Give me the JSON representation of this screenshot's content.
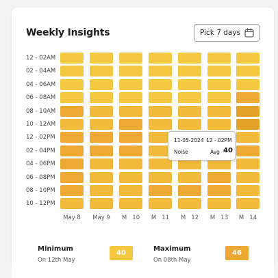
{
  "title": "Weekly Insights",
  "picker": {
    "label": "Pick 7 days",
    "icon": "calendar-icon"
  },
  "rows": [
    "12 - 02AM",
    "02 - 04AM",
    "04 - 06AM",
    "06 - 08AM",
    "08 - 10AM",
    "10 - 12AM",
    "12 - 02PM",
    "02 - 04PM",
    "04 - 06PM",
    "06 - 08PM",
    "08 - 10PM",
    "10 - 12PM"
  ],
  "columns": [
    "May 8",
    "May 9",
    "M   10",
    "M   11",
    "M   12",
    "M   13",
    "M   14"
  ],
  "heatmap_levels": [
    [
      0,
      0,
      0,
      0,
      0,
      0,
      0
    ],
    [
      0,
      0,
      0,
      0,
      0,
      0,
      0
    ],
    [
      0,
      0,
      0,
      0,
      0,
      0,
      0
    ],
    [
      0,
      0,
      0,
      0,
      0,
      0,
      2
    ],
    [
      2,
      1,
      1,
      1,
      1,
      1,
      3
    ],
    [
      1,
      1,
      2,
      1,
      1,
      1,
      3
    ],
    [
      2,
      2,
      2,
      1,
      1,
      1,
      1
    ],
    [
      2,
      2,
      2,
      1,
      1,
      1,
      2
    ],
    [
      2,
      1,
      1,
      1,
      1,
      1,
      1
    ],
    [
      2,
      1,
      1,
      1,
      1,
      2,
      1
    ],
    [
      2,
      1,
      1,
      2,
      2,
      2,
      1
    ],
    [
      1,
      1,
      1,
      1,
      1,
      1,
      1
    ]
  ],
  "colors": [
    "#f4c840",
    "#f2b93a",
    "#eea935",
    "#e5a22a"
  ],
  "tooltip": {
    "date": "11-05-2024",
    "time": "12 - 02PM",
    "metric": "Noise",
    "avg_label": "Avg",
    "avg_value": "40"
  },
  "stats": {
    "minimum": {
      "label": "Minimum",
      "sub": "On 12th May",
      "value": "40",
      "color": "#f4c840"
    },
    "maximum": {
      "label": "Maximum",
      "sub": "On 08th May",
      "value": "46",
      "color": "#eea935"
    }
  }
}
